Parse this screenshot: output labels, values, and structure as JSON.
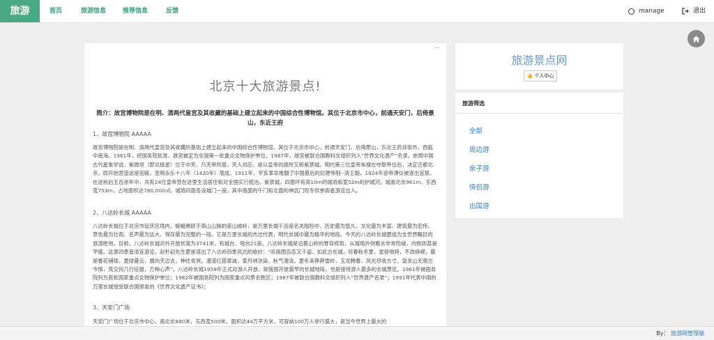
{
  "brand": "旅游",
  "nav": [
    {
      "label": "首页"
    },
    {
      "label": "旅游信息"
    },
    {
      "label": "推荐信息"
    },
    {
      "label": "反馈"
    }
  ],
  "user": {
    "name": "manage",
    "logout_label": "退出"
  },
  "article": {
    "title": "北京十大旅游景点!",
    "intro": "简介：故宫博物院是在明、清两代皇宫及其收藏的基础上建立起来的中国综合性博物馆。其位于北京市中心，前通天安门，后倚景山，东近王府",
    "sections": [
      {
        "heading": "1、故宫博物院 AAAAA",
        "body": "故宫博物院是在明、清两代皇宫及其收藏的基础上建立起来的中国综合性博物馆。其位于北京市中心，前通天安门，后倚景山，东近王府井街市，西临中南海。1961年，经国务院批准，故宫被定为全国第一批重点文物保护单位。1987年，故宫被联合国教科文组织列入“世界文化遗产”名录。依照中国古代星象学说，紫微垣（即北极星）位于中天，乃天帝所居，天人对应，是以皇帝的居所又称紫禁城。明代第三位皇帝朱棣在夺取帝位后，决定迁都北京，即开始营造这座宫殿，至明永乐十八年（1420年）落成。1911年，辛亥革命推翻了中国最后的封建帝制--清王朝，1924年逊帝溥仪被逐出宫禁。在这前后五百余年中，共有24位皇帝曾在这里生活居住和对全国实行统治。紫禁城，四面环有高10m的城墙和宽52m的护城河。城南北长961m，东西宽753m，占地面积达780,000㎡。城墙四面各设城门一座，其中南面的午门和北面的神武门现专供参观者游览出入。"
      },
      {
        "heading": "2、八达岭长城 AAAAA",
        "body": "八达岭长城位于北京市延庆区境内，蜿蜒腾跃于燕山山脉的崇山峻岭，是万里长城千百座名关隘险中，历史最为悠久、文化最为丰富、建筑最为宏伟、景色最为壮观、名声最为远大、保存最为完整的一段。它是万里长城的杰出代表，明代长城中最为精华的地段。今天的八达岭长城更成为全世界瞩目的旅游胜地。目前，八达岭长城对外开放长度为3741米，有城台、墙台21座。八达岭长城是沿着山岭的脊背修筑，从城墙外侧看去非常险峻，内侧则甚是平缓。这里四季皆适宜游览，赵朴初先生更是道出了八达岭四季风光的绝妙：“叹画图百态又千姿，如此古长城，尽春秋冬夏，星移物转，不改峥嵘。最是春花铺锦，夏绿叠云，展向天边去，神往青冥。漫道红霞翠减，爱丹林浓染，秋气澄清。更冬来莽莽雪岭，玉龙腾春，风光尽收方寸。望关山无限古今情，凭交何几行征履，万种心声”。八达岭长城1958年正式对游人开放，是我国开放最早的长城地段，也是接待游人最多的长城景区。1961年被国务院列为首批国家重点文物保护单位；1982年被国务院列为国家重点风景名胜区；1987年被联合国教科文组织列入“世界遗产名录”；1991年代表中国的万里长城接受联合国颁发的《世界文化遗产证书》；"
      },
      {
        "heading": "3、天安门广场",
        "body": "天安门广场位于北京市中心，南北长880米，东西宽500米，面积达44万平方米，可容纳100万人举行盛大，是当今世界上最大的"
      }
    ]
  },
  "site": {
    "name": "旅游景点网",
    "personal_label": "个人中心"
  },
  "filter": {
    "heading": "旅游筛选",
    "items": [
      {
        "label": "全部"
      },
      {
        "label": "周边游"
      },
      {
        "label": "亲子游"
      },
      {
        "label": "情侣游"
      },
      {
        "label": "出国游"
      }
    ]
  },
  "footer": {
    "prefix": "By：",
    "link": "旅游网管理端"
  }
}
